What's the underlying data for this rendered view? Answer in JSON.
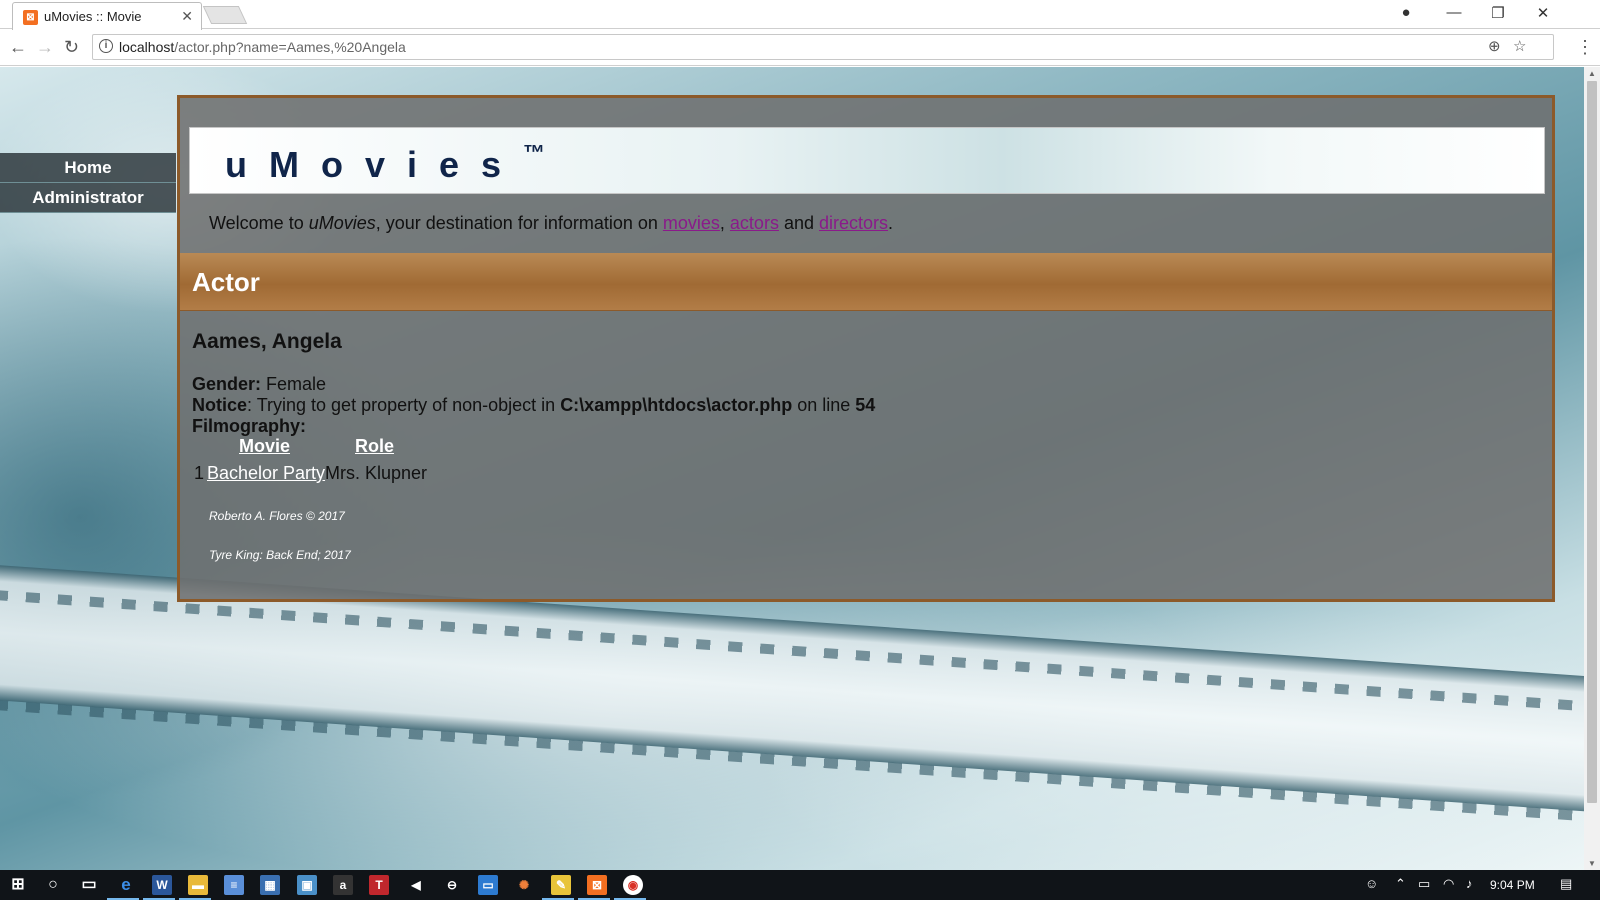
{
  "browser": {
    "tab_title": "uMovies :: Movie",
    "tab_favicon": "xampp-icon",
    "url_host": "localhost",
    "url_path": "/actor.php?name=Aames,%20Angela"
  },
  "sidenav": {
    "items": [
      {
        "label": "Home"
      },
      {
        "label": "Administrator"
      }
    ]
  },
  "header": {
    "brand": "uMovies",
    "trademark": "™",
    "welcome_prefix": "Welcome to ",
    "welcome_brand": "uMovies",
    "welcome_middle": ", your destination for information on ",
    "link_movies": "movies",
    "sep_comma": ", ",
    "link_actors": "actors",
    "sep_and": " and ",
    "link_directors": "directors",
    "welcome_end": "."
  },
  "section": {
    "title": "Actor"
  },
  "actor": {
    "name": "Aames, Angela",
    "gender_label": "Gender:",
    "gender_value": " Female",
    "notice_label": "Notice",
    "notice_text": ": Trying to get property of non-object in ",
    "notice_file": "C:\\xampp\\htdocs\\actor.php",
    "notice_online": " on line ",
    "notice_line": "54",
    "filmography_label": "Filmography:"
  },
  "filmography": {
    "headers": {
      "movie": "Movie",
      "role": "Role"
    },
    "rows": [
      {
        "num": "1",
        "movie": "Bachelor Party",
        "role": "Mrs. Klupner"
      }
    ]
  },
  "footer": {
    "credit1": "Roberto A. Flores © 2017",
    "credit2": "Tyre King: Back End; 2017"
  },
  "taskbar": {
    "clock": "9:04 PM"
  },
  "colors": {
    "panel_border": "#8c5a2a",
    "section_bar": "#a06a34",
    "link": "#8a1a8a",
    "brand_text": "#10254a"
  }
}
